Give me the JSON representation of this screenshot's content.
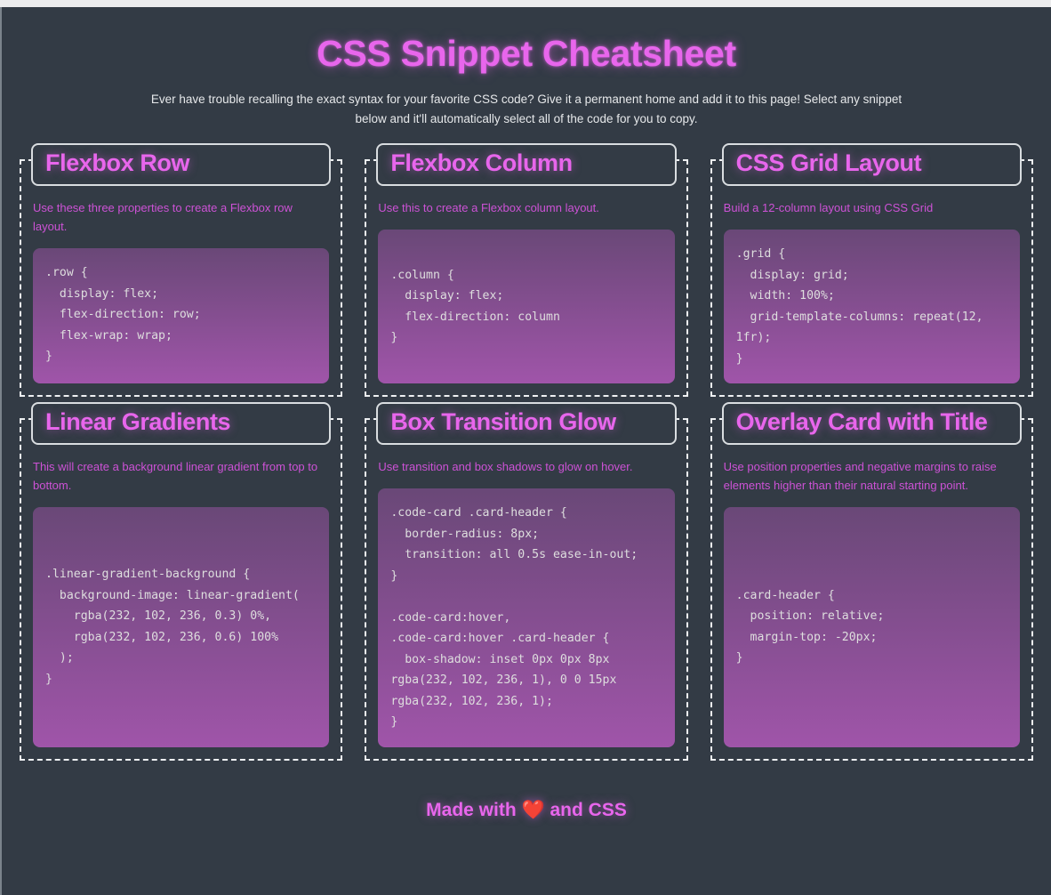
{
  "page": {
    "title": "CSS Snippet Cheatsheet",
    "subtitle": "Ever have trouble recalling the exact syntax for your favorite CSS code? Give it a permanent home and add it to this page! Select any snippet below and it'll automatically select all of the code for you to copy."
  },
  "colors": {
    "background": "#333b45",
    "accent": "#e866ec",
    "border": "#eef0f2",
    "code_text": "#dedede",
    "desc_text": "#cd52d6",
    "heart": "#ff3b30"
  },
  "cards": [
    {
      "title": "Flexbox Row",
      "description": "Use these three properties to create a Flexbox row layout.",
      "code": ".row {\n  display: flex;\n  flex-direction: row;\n  flex-wrap: wrap;\n}"
    },
    {
      "title": "Flexbox Column",
      "description": "Use this to create a Flexbox column layout.",
      "code": ".column {\n  display: flex;\n  flex-direction: column\n}"
    },
    {
      "title": "CSS Grid Layout",
      "description": "Build a 12-column layout using CSS Grid",
      "code": ".grid {\n  display: grid;\n  width: 100%;\n  grid-template-columns: repeat(12, 1fr);\n}"
    },
    {
      "title": "Linear Gradients",
      "description": "This will create a background linear gradient from top to bottom.",
      "code": ".linear-gradient-background {\n  background-image: linear-gradient(\n    rgba(232, 102, 236, 0.3) 0%,\n    rgba(232, 102, 236, 0.6) 100%\n  );\n}"
    },
    {
      "title": "Box Transition Glow",
      "description": "Use transition and box shadows to glow on hover.",
      "code": ".code-card .card-header {\n  border-radius: 8px;\n  transition: all 0.5s ease-in-out;\n}\n\n.code-card:hover,\n.code-card:hover .card-header {\n  box-shadow: inset 0px 0px 8px rgba(232, 102, 236, 1), 0 0 15px rgba(232, 102, 236, 1);\n}"
    },
    {
      "title": "Overlay Card with Title",
      "description": "Use position properties and negative margins to raise elements higher than their natural starting point.",
      "code": ".card-header {\n  position: relative;\n  margin-top: -20px;\n}"
    }
  ],
  "footer": {
    "prefix": "Made with ",
    "heart": "❤️",
    "suffix": " and CSS"
  }
}
